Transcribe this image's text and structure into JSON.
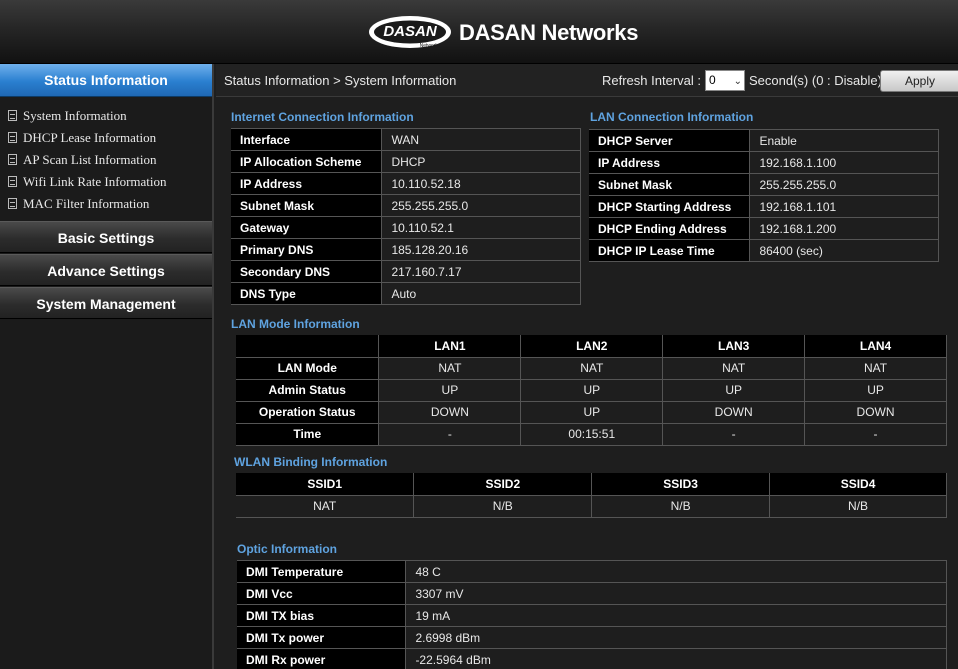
{
  "header": {
    "logo_text": "DASAN",
    "logo_sub": "Networks",
    "brand": "DASAN Networks"
  },
  "sidebar": {
    "active": "Status Information",
    "items": [
      "System Information",
      "DHCP Lease Information",
      "AP Scan List Information",
      "Wifi Link Rate Information",
      "MAC Filter Information"
    ],
    "sections": [
      "Basic Settings",
      "Advance Settings",
      "System Management"
    ]
  },
  "topbar": {
    "breadcrumb": "Status Information > System Information",
    "refresh_label": "Refresh Interval :",
    "refresh_value": "0",
    "refresh_unit": "Second(s) (0 : Disable)",
    "apply": "Apply"
  },
  "internet": {
    "title": "Internet Connection Information",
    "rows": [
      [
        "Interface",
        "WAN"
      ],
      [
        "IP Allocation Scheme",
        "DHCP"
      ],
      [
        "IP Address",
        "10.110.52.18"
      ],
      [
        "Subnet Mask",
        "255.255.255.0"
      ],
      [
        "Gateway",
        "10.110.52.1"
      ],
      [
        "Primary DNS",
        "185.128.20.16"
      ],
      [
        "Secondary DNS",
        "217.160.7.17"
      ],
      [
        "DNS Type",
        "Auto"
      ]
    ]
  },
  "lan": {
    "title": "LAN Connection Information",
    "rows": [
      [
        "DHCP Server",
        "Enable"
      ],
      [
        "IP Address",
        "192.168.1.100"
      ],
      [
        "Subnet Mask",
        "255.255.255.0"
      ],
      [
        "DHCP Starting Address",
        "192.168.1.101"
      ],
      [
        "DHCP Ending Address",
        "192.168.1.200"
      ],
      [
        "DHCP IP Lease Time",
        "86400 (sec)"
      ]
    ]
  },
  "lan_mode": {
    "title": "LAN Mode Information",
    "columns": [
      "LAN1",
      "LAN2",
      "LAN3",
      "LAN4"
    ],
    "rows": [
      [
        "LAN Mode",
        "NAT",
        "NAT",
        "NAT",
        "NAT"
      ],
      [
        "Admin Status",
        "UP",
        "UP",
        "UP",
        "UP"
      ],
      [
        "Operation Status",
        "DOWN",
        "UP",
        "DOWN",
        "DOWN"
      ],
      [
        "Time",
        "-",
        "00:15:51",
        "-",
        "-"
      ]
    ]
  },
  "wlan": {
    "title": "WLAN Binding Information",
    "columns": [
      "SSID1",
      "SSID2",
      "SSID3",
      "SSID4"
    ],
    "values": [
      "NAT",
      "N/B",
      "N/B",
      "N/B"
    ]
  },
  "optic": {
    "title": "Optic Information",
    "rows": [
      [
        "DMI Temperature",
        "48 C"
      ],
      [
        "DMI Vcc",
        "3307 mV"
      ],
      [
        "DMI TX bias",
        "19 mA"
      ],
      [
        "DMI Tx power",
        "2.6998 dBm"
      ],
      [
        "DMI Rx power",
        "-22.5964 dBm"
      ]
    ]
  }
}
